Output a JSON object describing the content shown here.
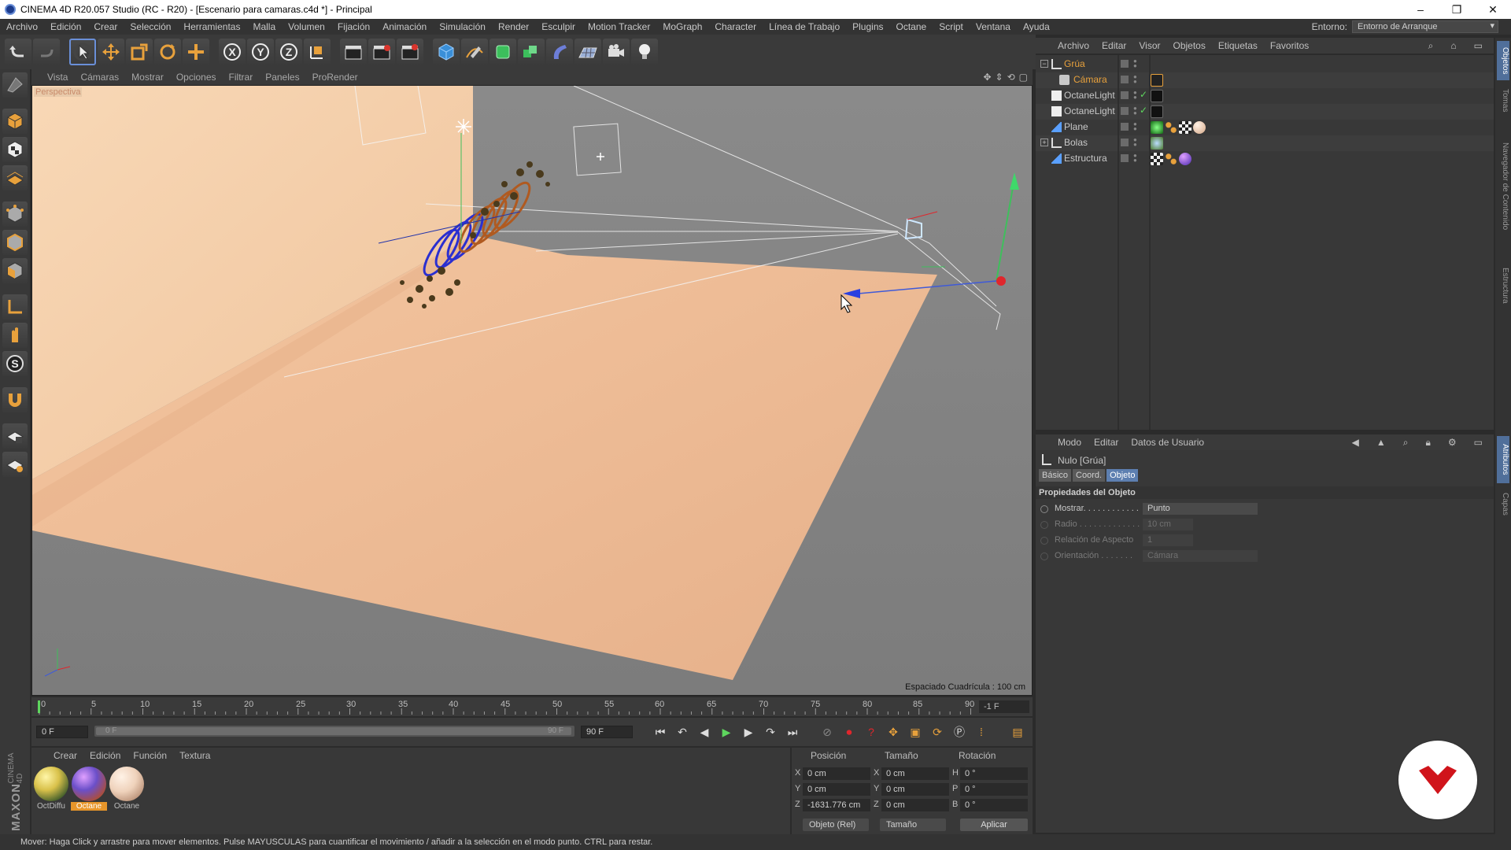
{
  "window": {
    "title": "CINEMA 4D R20.057 Studio (RC - R20) - [Escenario para camaras.c4d *] - Principal",
    "controls": [
      "–",
      "❐",
      "✕"
    ]
  },
  "menubar": {
    "items": [
      "Archivo",
      "Edición",
      "Crear",
      "Selección",
      "Herramientas",
      "Malla",
      "Volumen",
      "Fijación",
      "Animación",
      "Simulación",
      "Render",
      "Esculpir",
      "Motion Tracker",
      "MoGraph",
      "Character",
      "Línea de Trabajo",
      "Plugins",
      "Octane",
      "Script",
      "Ventana",
      "Ayuda"
    ],
    "env_label": "Entorno:",
    "env_value": "Entorno de Arranque"
  },
  "viewport": {
    "menu": [
      "Vista",
      "Cámaras",
      "Mostrar",
      "Opciones",
      "Filtrar",
      "Paneles",
      "ProRender"
    ],
    "label": "Perspectiva",
    "grid_spacing": "Espaciado Cuadrícula : 100 cm",
    "colors": {
      "wall": "#f6cfa8",
      "floor": "#f2c09a",
      "background": "#878787"
    }
  },
  "timeline": {
    "ticks": [
      "0",
      "5",
      "10",
      "15",
      "20",
      "25",
      "30",
      "35",
      "40",
      "45",
      "50",
      "55",
      "60",
      "65",
      "70",
      "75",
      "80",
      "85",
      "90"
    ],
    "current_frame_field": "-1 F",
    "start_field": "0 F",
    "range_start": "0 F",
    "range_end": "90 F",
    "end_field": "90 F"
  },
  "materials": {
    "menu": [
      "Crear",
      "Edición",
      "Función",
      "Textura"
    ],
    "items": [
      {
        "label": "OctDiffu",
        "selected": false,
        "color": "#d9c14a"
      },
      {
        "label": "Octane",
        "selected": true,
        "color": "#6b4fc9"
      },
      {
        "label": "Octane",
        "selected": false,
        "color": "#efd2bb"
      }
    ]
  },
  "coordinates": {
    "headers": {
      "pos": "Posición",
      "size": "Tamaño",
      "rot": "Rotación"
    },
    "rows": [
      {
        "axis": "X",
        "pos": "0 cm",
        "saxis": "X",
        "size": "0 cm",
        "raxis": "H",
        "rot": "0 °"
      },
      {
        "axis": "Y",
        "pos": "0 cm",
        "saxis": "Y",
        "size": "0 cm",
        "raxis": "P",
        "rot": "0 °"
      },
      {
        "axis": "Z",
        "pos": "-1631.776 cm",
        "saxis": "Z",
        "size": "0 cm",
        "raxis": "B",
        "rot": "0 °"
      }
    ],
    "mode": "Objeto (Rel)",
    "size_mode": "Tamaño",
    "apply": "Aplicar"
  },
  "object_manager": {
    "menu": [
      "Archivo",
      "Editar",
      "Visor",
      "Objetos",
      "Etiquetas",
      "Favoritos"
    ],
    "objects": [
      {
        "name": "Grúa",
        "highlight": true,
        "expander": "−"
      },
      {
        "name": "Cámara",
        "highlight": true,
        "expander": ""
      },
      {
        "name": "OctaneLight",
        "highlight": false,
        "expander": ""
      },
      {
        "name": "OctaneLight",
        "highlight": false,
        "expander": ""
      },
      {
        "name": "Plane",
        "highlight": false,
        "expander": ""
      },
      {
        "name": "Bolas",
        "highlight": false,
        "expander": "+"
      },
      {
        "name": "Estructura",
        "highlight": false,
        "expander": ""
      }
    ]
  },
  "attributes": {
    "menu": [
      "Modo",
      "Editar",
      "Datos de Usuario"
    ],
    "title": "Nulo [Grúa]",
    "tabs": [
      "Básico",
      "Coord.",
      "Objeto"
    ],
    "active_tab": "Objeto",
    "section": "Propiedades del Objeto",
    "props": [
      {
        "label": "Mostrar. . . . . . . . . . . .",
        "value": "Punto",
        "disabled": false
      },
      {
        "label": "Radio . . . . . . . . . . . . .",
        "value": "10 cm",
        "disabled": true
      },
      {
        "label": "Relación de Aspecto",
        "value": "1",
        "disabled": true
      },
      {
        "label": "Orientación . . . . . . .",
        "value": "Cámara",
        "disabled": true
      }
    ]
  },
  "right_tabs": [
    "Objetos",
    "Tomas",
    "Navegador de Contenido",
    "Estructura",
    "Atributos",
    "Capas"
  ],
  "statusbar": "Mover: Haga Click y arrastre para mover elementos. Pulse MAYUSCULAS para cuantificar el movimiento / añadir a la selección en el modo punto. CTRL para restar.",
  "branding": {
    "side_logo": "MAXON",
    "side_product": "CINEMA 4D",
    "badge_color": "#d0141b"
  }
}
